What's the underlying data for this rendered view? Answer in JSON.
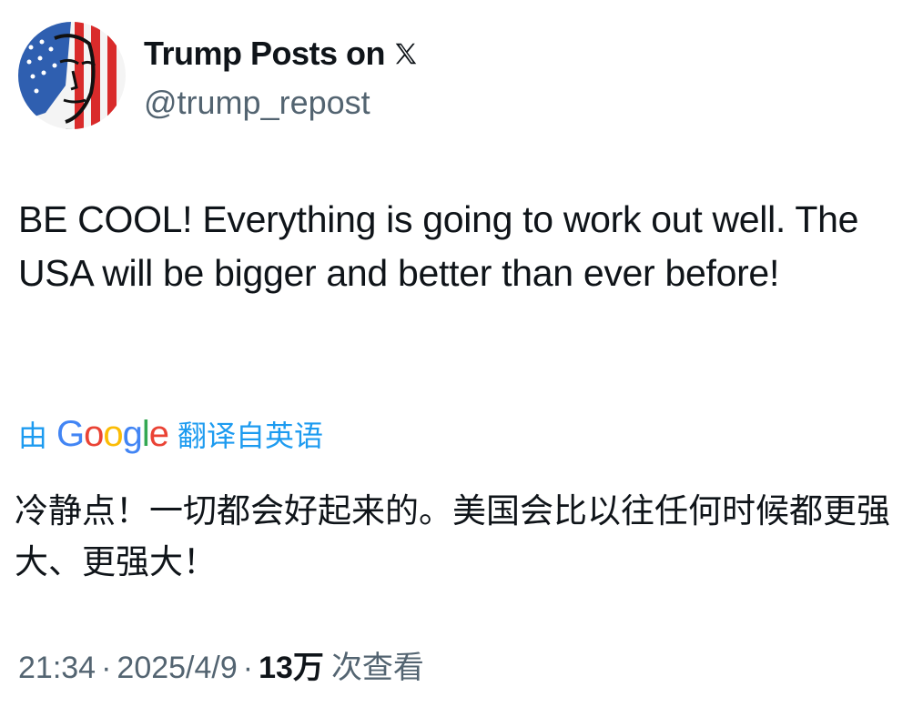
{
  "author": {
    "display_name": "Trump Posts on",
    "platform_icon": "x-logo-icon",
    "handle": "@trump_repost",
    "avatar_icon": "avatar-flag-portrait-icon"
  },
  "tweet": {
    "text": "BE COOL! Everything is going to work out well. The USA will be bigger and better than ever before!"
  },
  "translation": {
    "prefix": "由",
    "provider": "Google",
    "suffix": "翻译自英语",
    "text": "冷静点！一切都会好起来的。美国会比以往任何时候都更强大、更强大！"
  },
  "meta": {
    "time": "21:34",
    "separator": "·",
    "date": "2025/4/9",
    "views_count": "13万",
    "views_label": "次查看"
  },
  "colors": {
    "link": "#1d9bf0",
    "secondary_text": "#536471",
    "primary_text": "#0f1419",
    "google_blue": "#4285F4",
    "google_red": "#EA4335",
    "google_yellow": "#FBBC05",
    "google_green": "#34A853"
  }
}
